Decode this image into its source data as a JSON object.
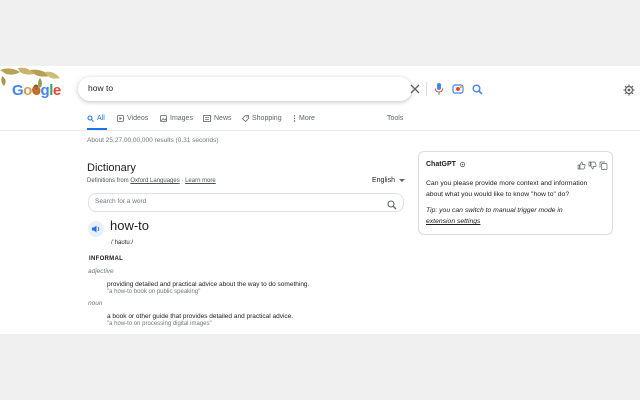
{
  "search": {
    "query": "how to"
  },
  "logo": {
    "text": "Google"
  },
  "tabs": [
    {
      "label": "All",
      "icon": "search-icon",
      "active": true
    },
    {
      "label": "Videos",
      "icon": "play-icon"
    },
    {
      "label": "Images",
      "icon": "image-icon"
    },
    {
      "label": "News",
      "icon": "news-icon"
    },
    {
      "label": "Shopping",
      "icon": "tag-icon"
    },
    {
      "label": "More",
      "icon": "more-icon"
    }
  ],
  "tools_label": "Tools",
  "results_stats": "About 25,27,00,00,000 results (0.31 seconds)",
  "dictionary": {
    "title": "Dictionary",
    "definitions_from": "Definitions from",
    "source": "Oxford Languages",
    "separator": "·",
    "learn_more": "Learn more",
    "language": "English",
    "search_placeholder": "Search for a word",
    "headword": "how-to",
    "phonetic": "/ˈhaʊtuː/",
    "register": "INFORMAL",
    "entries": [
      {
        "pos": "adjective",
        "definition": "providing detailed and practical advice about the way to do something.",
        "example": "\"a how-to book on public speaking\""
      },
      {
        "pos": "noun",
        "definition": "a book or other guide that provides detailed and practical advice.",
        "example": "\"a how-to on processing digital images\""
      }
    ]
  },
  "chatgpt": {
    "title": "ChatGPT",
    "message": "Can you please provide more context and information about what you would like to know \"how to\" do?",
    "tip_prefix": "Tip: you can switch to manual trigger mode in",
    "tip_link": "extension settings"
  },
  "colors": {
    "accent": "#1a73e8",
    "border": "#dadce0",
    "text": "#202124",
    "muted": "#70757a"
  }
}
